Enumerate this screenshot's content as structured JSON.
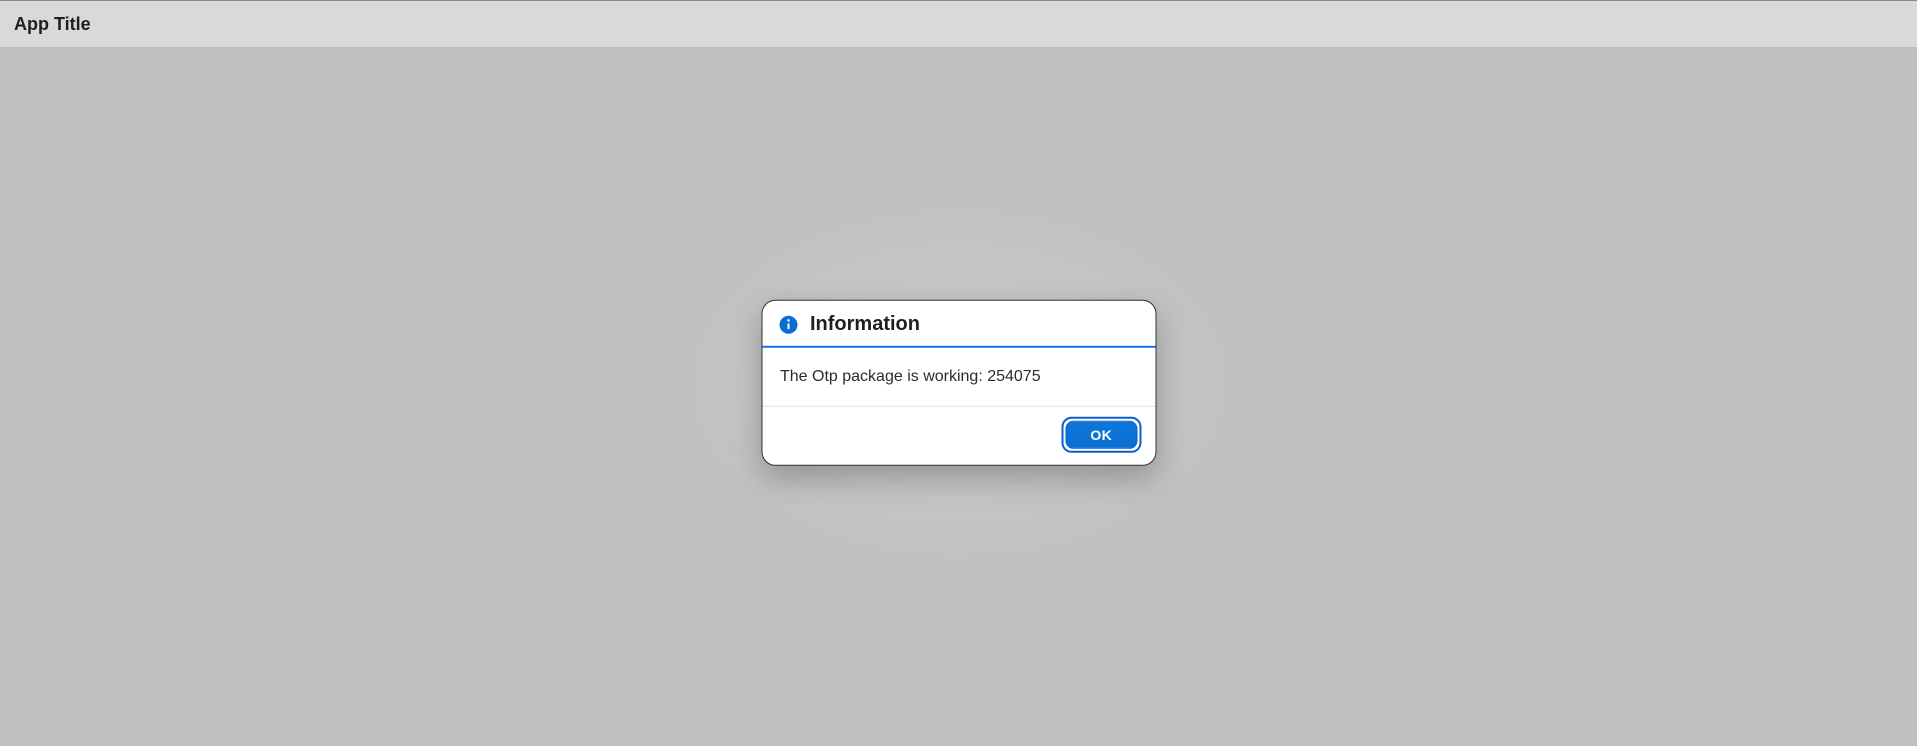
{
  "header": {
    "title": "App Title"
  },
  "dialog": {
    "title": "Information",
    "message": "The Otp package is working: 254075",
    "ok_label": "OK",
    "icon": "info-icon",
    "accent_color": "#0a6ed1"
  }
}
